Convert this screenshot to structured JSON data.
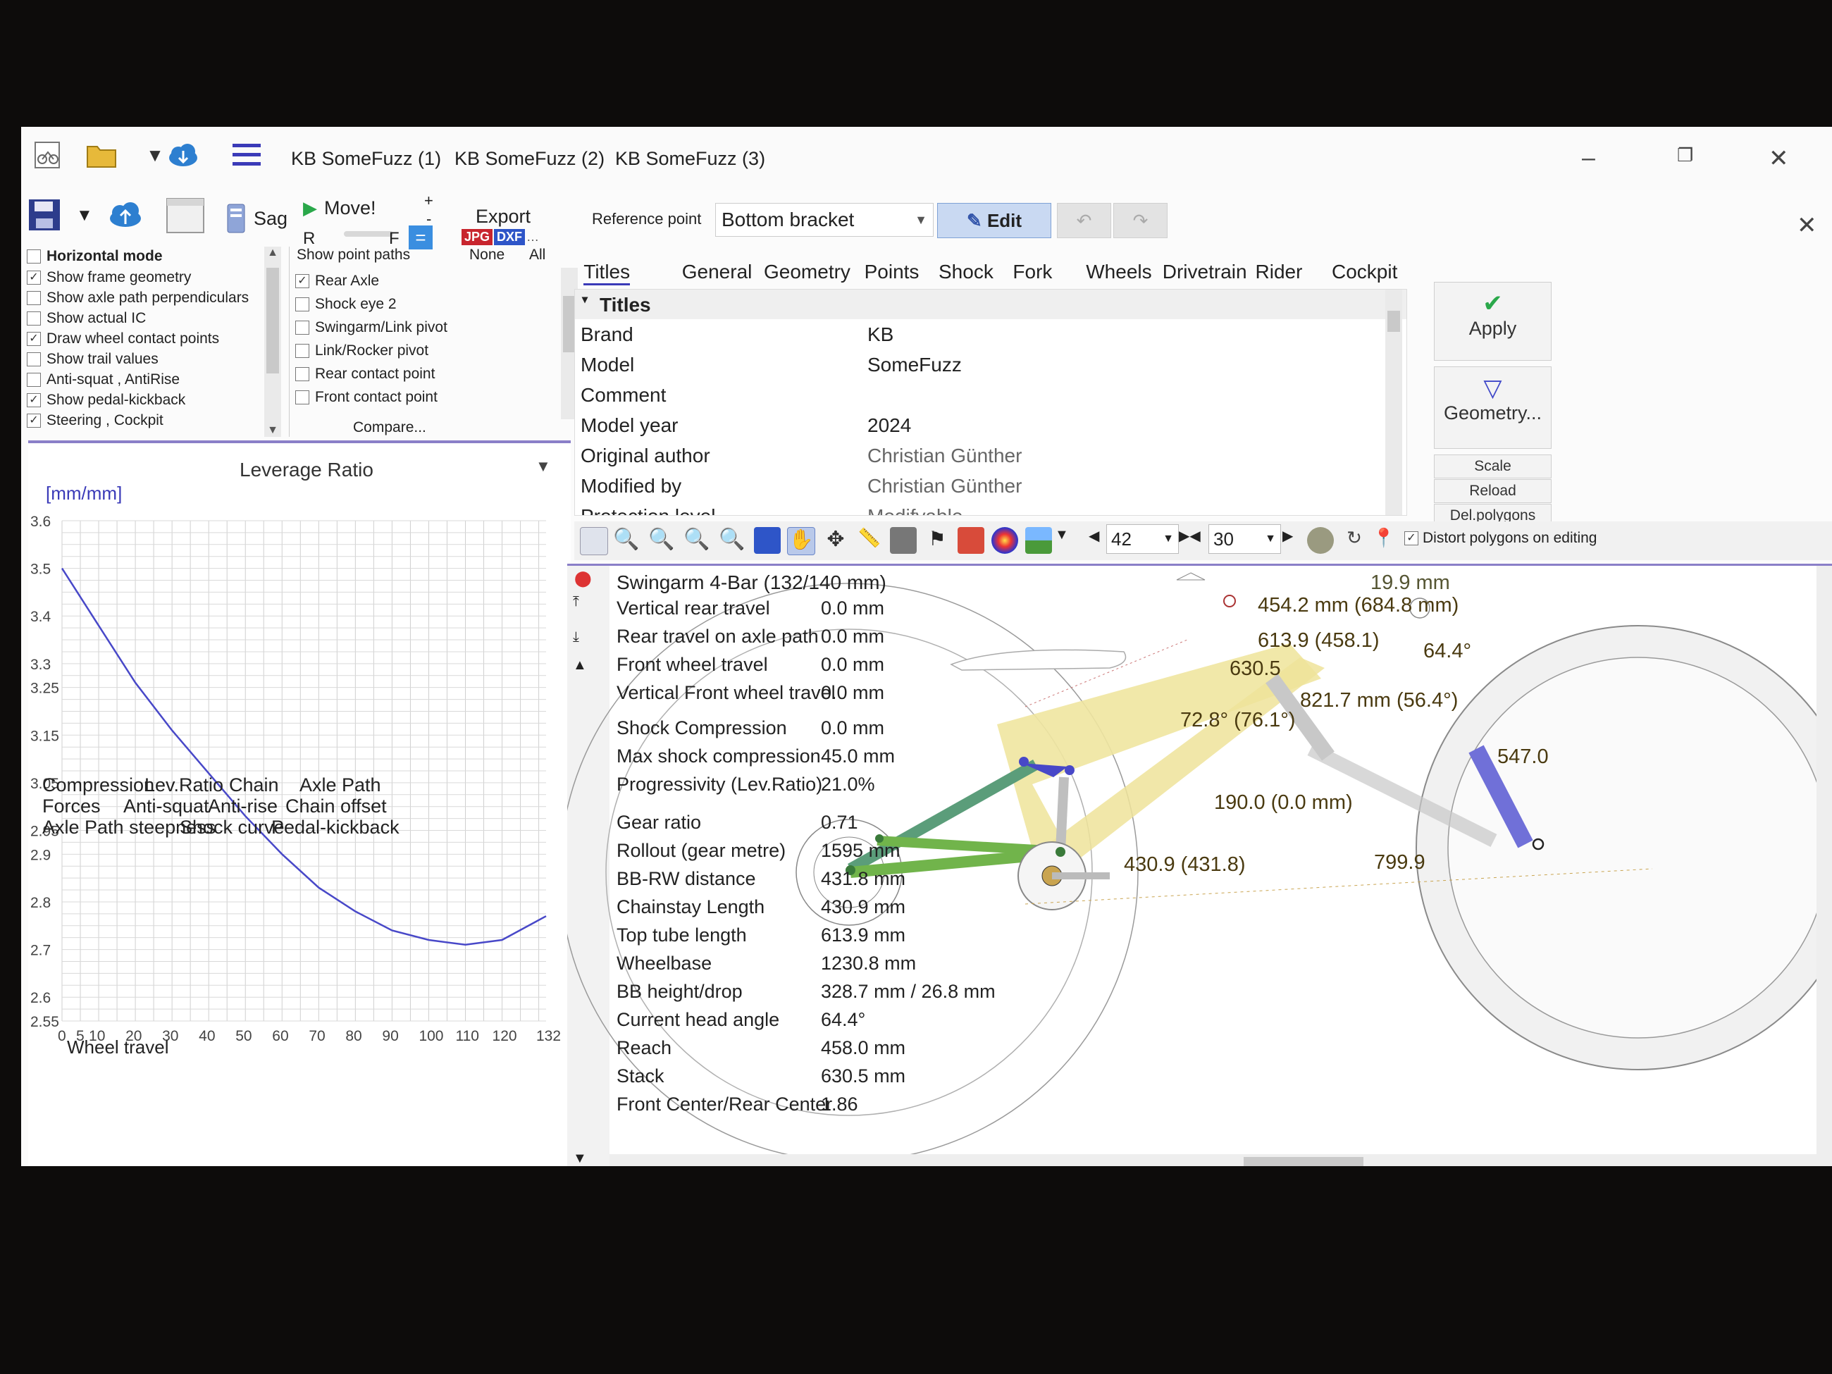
{
  "titlebar": {
    "tabs": [
      "KB SomeFuzz (1)",
      "KB SomeFuzz (2)",
      "KB SomeFuzz (3)"
    ]
  },
  "toolbar": {
    "sag_label": "Sag",
    "move_label": "Move!",
    "export_label": "Export",
    "r_label": "R",
    "f_label": "F",
    "jpg_label": "JPG",
    "dxf_label": "DXF",
    "plus": "+",
    "minus": "-",
    "equals": "="
  },
  "options": {
    "header": "Horizontal mode",
    "items": [
      {
        "label": "Show frame geometry",
        "checked": true
      },
      {
        "label": "Show axle path perpendiculars",
        "checked": false
      },
      {
        "label": "Show actual IC",
        "checked": false
      },
      {
        "label": "Draw wheel contact points",
        "checked": true
      },
      {
        "label": "Show trail values",
        "checked": false
      },
      {
        "label": "Anti-squat , AntiRise",
        "checked": false
      },
      {
        "label": "Show pedal-kickback",
        "checked": true
      },
      {
        "label": "Steering , Cockpit",
        "checked": true
      }
    ]
  },
  "point_paths": {
    "header": "Show point paths",
    "none": "None",
    "all": "All",
    "items": [
      {
        "label": "Rear Axle",
        "checked": true
      },
      {
        "label": "Shock eye 2",
        "checked": false
      },
      {
        "label": "Swingarm/Link pivot",
        "checked": false
      },
      {
        "label": "Link/Rocker pivot",
        "checked": false
      },
      {
        "label": "Rear contact point",
        "checked": false
      },
      {
        "label": "Front contact point",
        "checked": false
      }
    ],
    "compare": "Compare..."
  },
  "chart": {
    "title": "Leverage Ratio",
    "unit": "[mm/mm]",
    "xlabel": "Wheel travel",
    "y_ticks": [
      "3.6",
      "3.5",
      "3.4",
      "3.3",
      "3.25",
      "3.15",
      "3.05",
      "2.95",
      "2.9",
      "2.8",
      "2.7",
      "2.6",
      "2.55"
    ],
    "x_ticks": [
      "0",
      "5",
      "10",
      "20",
      "30",
      "40",
      "50",
      "60",
      "70",
      "80",
      "90",
      "100",
      "110",
      "120",
      "132"
    ]
  },
  "chart_data": {
    "type": "line",
    "title": "Leverage Ratio",
    "xlabel": "Wheel travel",
    "ylabel": "[mm/mm]",
    "xlim": [
      0,
      132
    ],
    "ylim": [
      2.55,
      3.6
    ],
    "grid": true,
    "x": [
      0,
      10,
      20,
      30,
      40,
      50,
      60,
      70,
      80,
      90,
      100,
      110,
      120,
      132
    ],
    "y": [
      3.5,
      3.38,
      3.26,
      3.16,
      3.07,
      2.98,
      2.9,
      2.83,
      2.78,
      2.74,
      2.72,
      2.71,
      2.72,
      2.77
    ]
  },
  "bottom_tabs": [
    [
      "Compression",
      "Lev.Ratio",
      "Chain",
      "Axle Path"
    ],
    [
      "Forces",
      "Anti-squat",
      "Anti-rise",
      "Chain offset"
    ],
    [
      "Axle Path steepness",
      "Shock curve",
      "Pedal-kickback"
    ]
  ],
  "reference": {
    "label": "Reference point",
    "value": "Bottom bracket",
    "edit": "Edit"
  },
  "main_tabs": [
    "Titles",
    "General",
    "Geometry",
    "Points",
    "Shock",
    "Fork",
    "Wheels",
    "Drivetrain",
    "Rider",
    "Cockpit"
  ],
  "titles_section": "Titles",
  "properties": [
    {
      "name": "Brand",
      "value": "KB"
    },
    {
      "name": "Model",
      "value": "SomeFuzz"
    },
    {
      "name": "Comment",
      "value": ""
    },
    {
      "name": "Model year",
      "value": "2024"
    },
    {
      "name": "Original author",
      "value": "Christian Günther"
    },
    {
      "name": "Modified by",
      "value": "Christian Günther"
    },
    {
      "name": "Protection level",
      "value": "Modifyable"
    }
  ],
  "side_buttons": {
    "apply": "Apply",
    "geometry": "Geometry...",
    "scale": "Scale",
    "reload": "Reload",
    "del_polygons": "Del.polygons"
  },
  "toolbar2": {
    "val1": "42",
    "val2": "30",
    "distort_label": "Distort polygons on editing",
    "distort_checked": true
  },
  "canvas_info": {
    "title": "Swingarm 4-Bar (132/140 mm)",
    "rows": [
      {
        "label": "Vertical rear travel",
        "value": "0.0 mm"
      },
      {
        "label": "Rear travel on axle path",
        "value": "0.0 mm"
      },
      {
        "label": "Front wheel travel",
        "value": "0.0 mm"
      },
      {
        "label": "Vertical Front wheel travel",
        "value": "0.0 mm"
      },
      {
        "label": "Shock Compression",
        "value": "0.0 mm"
      },
      {
        "label": "Max shock compression",
        "value": "45.0 mm"
      },
      {
        "label": "Progressivity (Lev.Ratio)",
        "value": "21.0%"
      },
      {
        "label": "Gear ratio",
        "value": "0.71"
      },
      {
        "label": "Rollout (gear metre)",
        "value": "1595 mm"
      },
      {
        "label": "BB-RW distance",
        "value": "431.8 mm"
      },
      {
        "label": "Chainstay Length",
        "value": "430.9 mm"
      },
      {
        "label": "Top tube length",
        "value": "613.9 mm"
      },
      {
        "label": "Wheelbase",
        "value": "1230.8 mm"
      },
      {
        "label": "BB height/drop",
        "value": "328.7 mm / 26.8 mm"
      },
      {
        "label": "Current head angle",
        "value": "64.4°"
      },
      {
        "label": "Reach",
        "value": "458.0 mm"
      },
      {
        "label": "Stack",
        "value": "630.5 mm"
      },
      {
        "label": "Front Center/Rear Center",
        "value": "1.86"
      }
    ]
  },
  "geometry_labels": {
    "top_right": "19.9 mm",
    "seat_height": "454.2 mm (684.8 mm)",
    "top_tube": "613.9 (458.1)",
    "head_angle": "64.4°",
    "stack": "630.5",
    "seat_tube": "821.7 mm (56.4°)",
    "seat_angle": "72.8° (76.1°)",
    "fork_length": "547.0",
    "shock": "190.0 (0.0 mm)",
    "chainstay_overlay": "430.9 (431.8)",
    "front_center": "799.9"
  }
}
